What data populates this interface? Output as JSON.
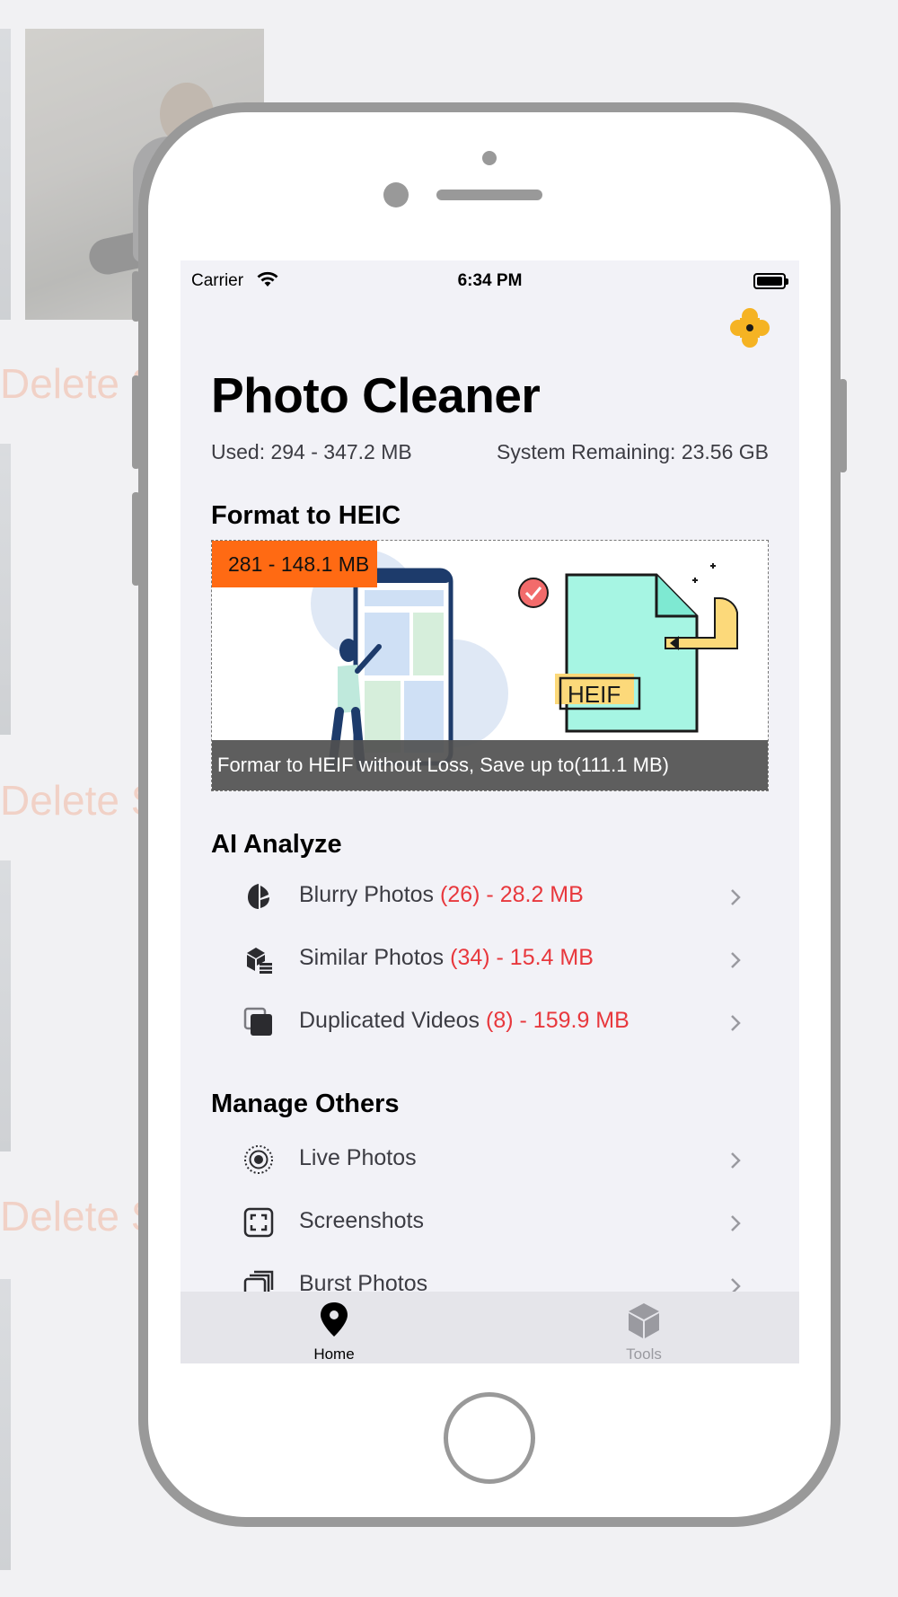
{
  "background": {
    "delete_label": "Delete Se"
  },
  "status_bar": {
    "carrier": "Carrier",
    "time": "6:34 PM"
  },
  "header": {
    "title": "Photo Cleaner",
    "used": "Used: 294 - 347.2 MB",
    "remaining": "System Remaining: 23.56 GB"
  },
  "heic": {
    "heading": "Format to HEIC",
    "badge": "281 - 148.1 MB",
    "badge_color": "#ff6a13",
    "file_label": "HEIF",
    "caption": "Formar to HEIF without Loss, Save up to(111.1 MB)"
  },
  "ai_analyze": {
    "heading": "AI Analyze",
    "items": [
      {
        "label": "Blurry Photos ",
        "stat": "(26) - 28.2 MB",
        "icon": "leaf-icon"
      },
      {
        "label": "Similar Photos ",
        "stat": "(34) - 15.4 MB",
        "icon": "boxes-stack-icon"
      },
      {
        "label": "Duplicated Videos ",
        "stat": "(8) - 159.9 MB",
        "icon": "duplicate-squares-icon"
      }
    ]
  },
  "manage_others": {
    "heading": "Manage Others",
    "items": [
      {
        "label": "Live Photos",
        "icon": "live-photo-icon"
      },
      {
        "label": "Screenshots",
        "icon": "screenshot-icon"
      },
      {
        "label": "Burst Photos",
        "icon": "burst-photos-icon"
      }
    ]
  },
  "tab_bar": {
    "tabs": [
      {
        "label": "Home",
        "icon": "map-pin-icon",
        "active": true
      },
      {
        "label": "Tools",
        "icon": "cube-icon",
        "active": false
      }
    ]
  },
  "colors": {
    "accent_orange": "#ff6a13",
    "stat_red": "#e8383d",
    "logo_yellow": "#f5b323"
  }
}
